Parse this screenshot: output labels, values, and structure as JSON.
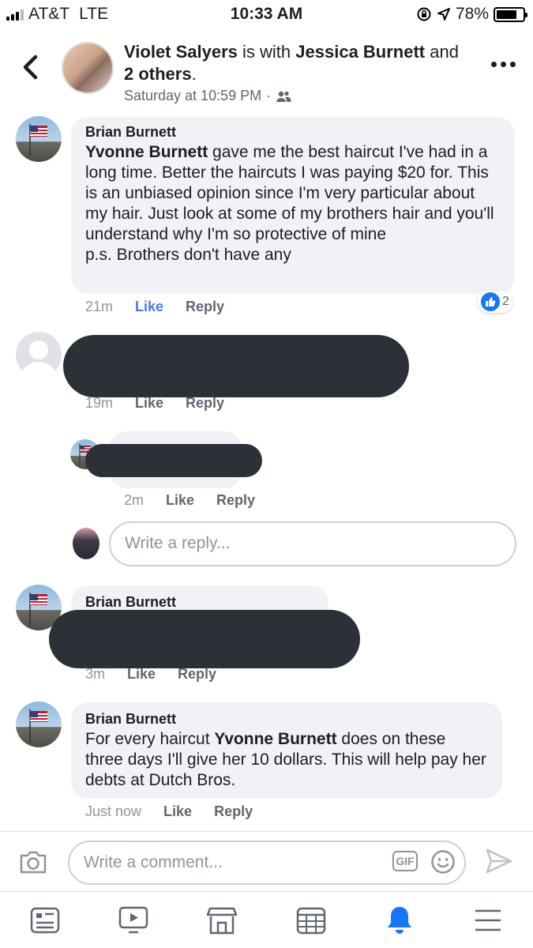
{
  "status_bar": {
    "carrier": "AT&T",
    "network": "LTE",
    "time": "10:33 AM",
    "battery": "78%",
    "battery_level": 0.78
  },
  "header": {
    "author": "Violet Salyers",
    "with_text": "is with",
    "tagged": "Jessica Burnett",
    "and_text": "and",
    "others": "2 others",
    "period": ".",
    "timestamp": "Saturday at 10:59 PM",
    "separator": "·"
  },
  "comments": [
    {
      "author": "Brian Burnett",
      "mention": "Yvonne Burnett",
      "text": " gave me the best haircut I've had in a long time.  Better the haircuts I was paying $20 for.  This is an unbiased opinion since I'm very particular about my hair.  Just look at some of my brothers hair and you'll understand why I'm so protective of mine",
      "text_ps": "p.s. Brothers don't have any",
      "time": "21m",
      "like": "Like",
      "reply": "Reply",
      "reaction_count": "2"
    },
    {
      "time": "19m",
      "like": "Like",
      "reply": "Reply"
    },
    {
      "time": "2m",
      "like": "Like",
      "reply": "Reply"
    },
    {
      "author": "Brian Burnett",
      "time": "3m",
      "like": "Like",
      "reply": "Reply"
    },
    {
      "author": "Brian Burnett",
      "text_pre": "For every haircut ",
      "mention": "Yvonne Burnett",
      "text_post": " does on these three days I'll give her 10 dollars.  This will help pay her debts at Dutch Bros.",
      "time": "Just now",
      "like": "Like",
      "reply": "Reply"
    }
  ],
  "reply_box": {
    "placeholder": "Write a reply..."
  },
  "composer": {
    "placeholder": "Write a comment...",
    "gif_label": "GIF"
  },
  "icons": {
    "back": "chevron-left-icon",
    "more": "more-horizontal-icon",
    "audience": "friends-icon",
    "camera": "camera-icon",
    "emoji": "emoji-icon",
    "send": "send-icon",
    "tabs": [
      "news-feed-icon",
      "watch-icon",
      "marketplace-icon",
      "events-icon",
      "notifications-icon",
      "menu-icon"
    ]
  },
  "colors": {
    "link_blue": "#4a7be2",
    "bubble_bg": "#f0f2f5",
    "active_tab": "#1877f2",
    "redaction": "#2c3138"
  }
}
